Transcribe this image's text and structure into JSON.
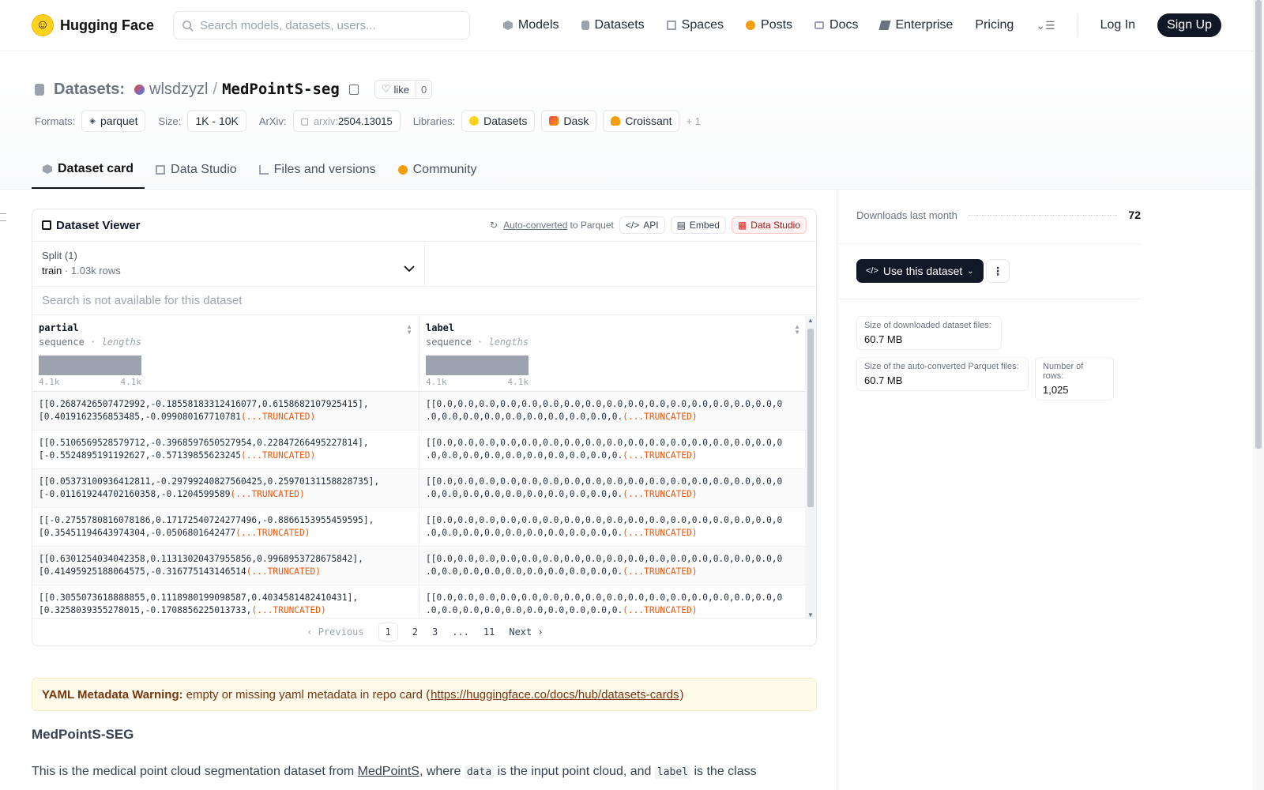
{
  "nav": {
    "brand": "Hugging Face",
    "search_placeholder": "Search models, datasets, users...",
    "links": [
      "Models",
      "Datasets",
      "Spaces",
      "Posts",
      "Docs",
      "Enterprise",
      "Pricing"
    ],
    "login": "Log In",
    "signup": "Sign Up"
  },
  "header": {
    "section": "Datasets:",
    "org": "wlsdzyzl",
    "sep": "/",
    "name": "MedPointS-seg",
    "like_label": "like",
    "like_count": "0",
    "formats_label": "Formats:",
    "format": "parquet",
    "size_label": "Size:",
    "size": "1K - 10K",
    "arxiv_label": "ArXiv:",
    "arxiv_prefix": "arxiv:",
    "arxiv_id": "2504.13015",
    "libraries_label": "Libraries:",
    "libraries": [
      "Datasets",
      "Dask",
      "Croissant"
    ],
    "libraries_more": "+ 1"
  },
  "tabs": [
    "Dataset card",
    "Data Studio",
    "Files and versions",
    "Community"
  ],
  "viewer": {
    "title": "Dataset Viewer",
    "auto_converted": "Auto-converted",
    "to_parquet": "to Parquet",
    "api": "API",
    "embed": "Embed",
    "data_studio": "Data Studio",
    "split_label": "Split (1)",
    "split_name": "train",
    "split_dot": "·",
    "split_rows": "1.03k rows",
    "search_placeholder": "Search is not available for this dataset",
    "columns": [
      {
        "name": "partial",
        "type": "sequence",
        "sub": "· lengths",
        "min": "4.1k",
        "max": "4.1k"
      },
      {
        "name": "label",
        "type": "sequence",
        "sub": "· lengths",
        "min": "4.1k",
        "max": "4.1k"
      }
    ],
    "truncated": "(...TRUNCATED)",
    "rows": [
      {
        "a1": "[[0.2687426507472992,-0.18558183312416077,0.6158682107925415],",
        "a2": "[0.4019162356853485,-0.099080167710781",
        "b1": "[[0.0,0.0,0.0,0.0,0.0,0.0,0.0,0.0,0.0,0.0,0.0,0.0,0.0,0.0,0.0,0.0,0",
        "b2": ".0,0.0,0.0,0.0,0.0,0.0,0.0,0.0,0.0,0."
      },
      {
        "a1": "[[0.5106569528579712,-0.3968597650527954,0.22847266495227814],",
        "a2": "[-0.5524895191192627,-0.57139855623245",
        "b1": "[[0.0,0.0,0.0,0.0,0.0,0.0,0.0,0.0,0.0,0.0,0.0,0.0,0.0,0.0,0.0,0.0,0",
        "b2": ".0,0.0,0.0,0.0,0.0,0.0,0.0,0.0,0.0,0."
      },
      {
        "a1": "[[0.05373100936412811,-0.29799240827560425,0.25970131158828735],",
        "a2": "[-0.011619244702160358,-0.1204599589",
        "b1": "[[0.0,0.0,0.0,0.0,0.0,0.0,0.0,0.0,0.0,0.0,0.0,0.0,0.0,0.0,0.0,0.0,0",
        "b2": ".0,0.0,0.0,0.0,0.0,0.0,0.0,0.0,0.0,0."
      },
      {
        "a1": "[[-0.2755780816078186,0.17172540724277496,-0.8866153955459595],",
        "a2": "[0.35451194643974304,-0.0506801642477",
        "b1": "[[0.0,0.0,0.0,0.0,0.0,0.0,0.0,0.0,0.0,0.0,0.0,0.0,0.0,0.0,0.0,0.0,0",
        "b2": ".0,0.0,0.0,0.0,0.0,0.0,0.0,0.0,0.0,0."
      },
      {
        "a1": "[[0.6301254034042358,0.11313020437955856,0.9968953728675842],",
        "a2": "[0.41495925188064575,-0.316775143146514",
        "b1": "[[0.0,0.0,0.0,0.0,0.0,0.0,0.0,0.0,0.0,0.0,0.0,0.0,0.0,0.0,0.0,0.0,0",
        "b2": ".0,0.0,0.0,0.0,0.0,0.0,0.0,0.0,0.0,0."
      },
      {
        "a1": "[[0.3055073618888855,0.1118980199098587,0.4034581482410431],",
        "a2": "[0.3258039355278015,-0.1708856225013733,",
        "b1": "[[0.0,0.0,0.0,0.0,0.0,0.0,0.0,0.0,0.0,0.0,0.0,0.0,0.0,0.0,0.0,0.0,0",
        "b2": ".0,0.0,0.0,0.0,0.0,0.0,0.0,0.0,0.0,0."
      }
    ],
    "pager": {
      "prev": "Previous",
      "pages": [
        "1",
        "2",
        "3",
        "...",
        "11"
      ],
      "next": "Next"
    }
  },
  "warning": {
    "bold": "YAML Metadata Warning:",
    "text": "empty or missing yaml metadata in repo card (",
    "link": "https://huggingface.co/docs/hub/datasets-cards",
    "close": ")"
  },
  "card": {
    "heading": "MedPointS-SEG",
    "p1": "This is the medical point cloud segmentation dataset from",
    "link": "MedPointS",
    "p2": ", where",
    "code1": "data",
    "p3": "is the input point cloud, and",
    "code2": "label",
    "p4": "is the class"
  },
  "sidebar": {
    "downloads_label": "Downloads last month",
    "downloads": "72",
    "use_button": "Use this dataset",
    "stats": [
      {
        "label": "Size of downloaded dataset files:",
        "value": "60.7 MB"
      },
      {
        "label": "Size of the auto-converted Parquet files:",
        "value": "60.7 MB"
      },
      {
        "label": "Number of rows:",
        "value": "1,025"
      }
    ]
  },
  "colors": {
    "accent_dark": "#111827",
    "warning_bg": "#fffbeb",
    "truncated": "#ea580c",
    "brand_yellow": "#ffd21e"
  }
}
